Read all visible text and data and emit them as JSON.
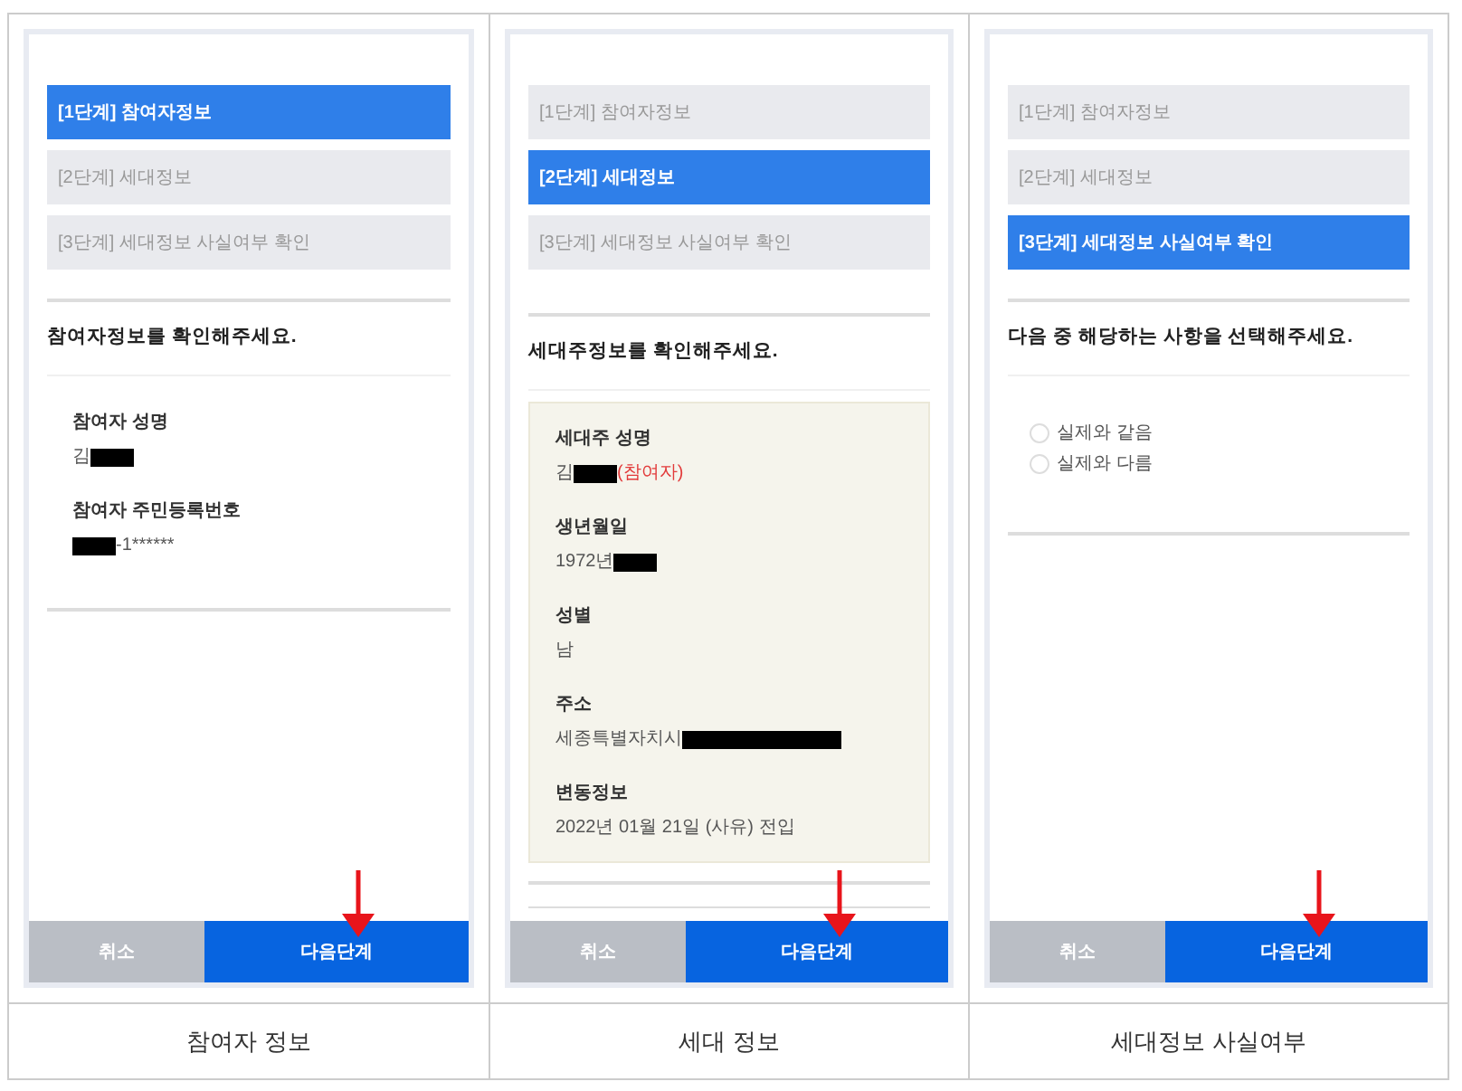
{
  "panels": [
    {
      "kind": "participant",
      "steps": [
        {
          "label": "[1단계] 참여자정보",
          "selected": true
        },
        {
          "label": "[2단계] 세대정보",
          "selected": false
        },
        {
          "label": "[3단계] 세대정보 사실여부 확인",
          "selected": false
        }
      ],
      "prompt": "참여자정보를 확인해주세요.",
      "fields": [
        {
          "label": "참여자 성명",
          "value": [
            {
              "kind": "text",
              "text": "김"
            },
            {
              "kind": "redacted"
            }
          ]
        },
        {
          "label": "참여자 주민등록번호",
          "value": [
            {
              "kind": "redacted"
            },
            {
              "kind": "text",
              "text": "-1******"
            }
          ]
        }
      ],
      "buttons": [
        {
          "label": "취소",
          "kind": "cancel"
        },
        {
          "label": "다음단계",
          "kind": "next"
        }
      ],
      "caption": "참여자 정보"
    },
    {
      "kind": "household",
      "steps": [
        {
          "label": "[1단계] 참여자정보",
          "selected": false
        },
        {
          "label": "[2단계] 세대정보",
          "selected": true
        },
        {
          "label": "[3단계] 세대정보 사실여부 확인",
          "selected": false
        }
      ],
      "prompt": "세대주정보를 확인해주세요.",
      "fields": [
        {
          "label": "세대주 성명",
          "value": [
            {
              "kind": "text",
              "text": "김"
            },
            {
              "kind": "redacted"
            },
            {
              "kind": "note",
              "text": "(참여자)"
            }
          ]
        },
        {
          "label": "생년월일",
          "value": [
            {
              "kind": "text",
              "text": "1972년"
            },
            {
              "kind": "redacted"
            }
          ]
        },
        {
          "label": "성별",
          "value": [
            {
              "kind": "text",
              "text": "남"
            }
          ]
        },
        {
          "label": "주소",
          "value": [
            {
              "kind": "text",
              "text": "세종특별자치시"
            },
            {
              "kind": "redacted",
              "wide": true
            }
          ]
        },
        {
          "label": "변동정보",
          "value": [
            {
              "kind": "text",
              "text": "2022년 01월 21일 (사유) 전입"
            }
          ]
        }
      ],
      "buttons": [
        {
          "label": "취소",
          "kind": "cancel"
        },
        {
          "label": "다음단계",
          "kind": "next"
        }
      ],
      "caption": "세대 정보"
    },
    {
      "kind": "choice",
      "steps": [
        {
          "label": "[1단계] 참여자정보",
          "selected": false
        },
        {
          "label": "[2단계] 세대정보",
          "selected": false
        },
        {
          "label": "[3단계] 세대정보 사실여부 확인",
          "selected": true
        }
      ],
      "prompt": "다음 중 해당하는 사항을 선택해주세요.",
      "options": [
        {
          "label": "실제와 같음",
          "selected": false
        },
        {
          "label": "실제와 다름",
          "selected": false
        }
      ],
      "buttons": [
        {
          "label": "취소",
          "kind": "cancel"
        },
        {
          "label": "다음단계",
          "kind": "next"
        }
      ],
      "caption": "세대정보 사실여부"
    }
  ]
}
